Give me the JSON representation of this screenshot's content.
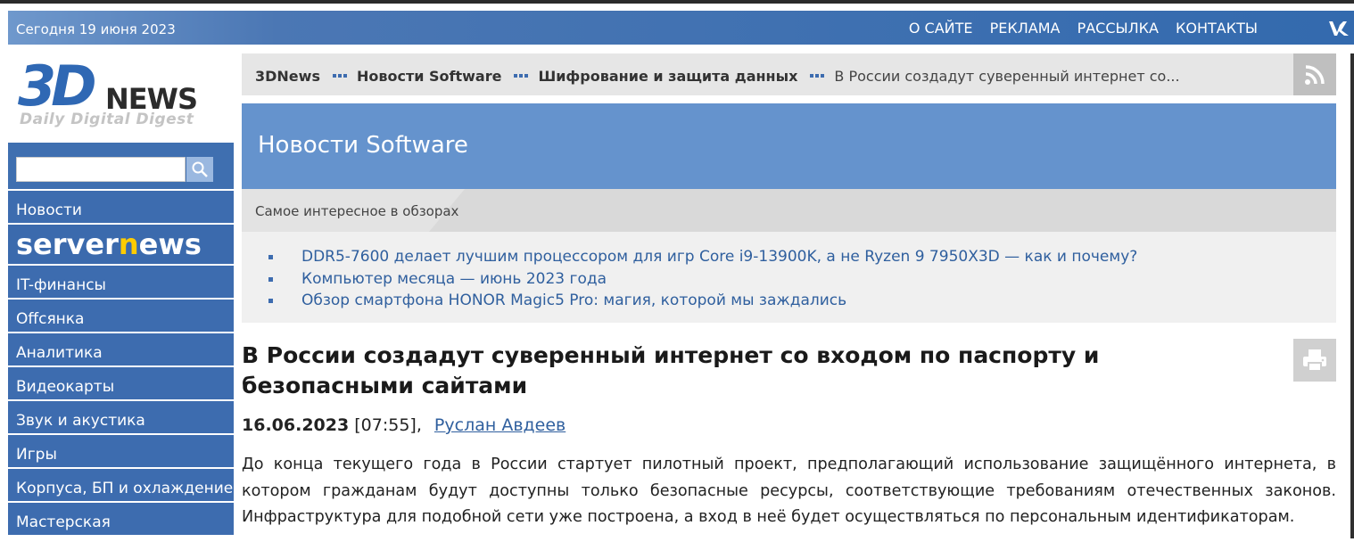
{
  "topbar": {
    "date": "Сегодня 19 июня 2023",
    "menu": [
      "О САЙТЕ",
      "РЕКЛАМА",
      "РАССЫЛКА",
      "КОНТАКТЫ"
    ],
    "social_icon": "vk-icon"
  },
  "logo": {
    "big": "3D",
    "news": "NEWS",
    "tagline": "Daily Digital Digest"
  },
  "search": {
    "value": "",
    "icon": "search-icon"
  },
  "nav": [
    "Новости",
    "servernews",
    "IT-финансы",
    "Offсянка",
    "Аналитика",
    "Видеокарты",
    "Звук и акустика",
    "Игры",
    "Корпуса, БП и охлаждение",
    "Мастерская"
  ],
  "breadcrumb": {
    "items": [
      "3DNews",
      "Новости Software",
      "Шифрование и защита данных"
    ],
    "current": "В России создадут суверенный интернет со..."
  },
  "section": {
    "title": "Новости Software"
  },
  "interesting": {
    "heading": "Самое интересное в обзорах",
    "items": [
      "DDR5-7600 делает лучшим процессором для игр Core i9-13900K, а не Ryzen 9 7950X3D — как и почему?",
      "Компьютер месяца — июнь 2023 года",
      "Обзор смартфона HONOR Magic5 Pro: магия, которой мы заждались"
    ]
  },
  "article": {
    "title": "В России создадут суверенный интернет со входом по паспорту и безопасными сайтами",
    "date": "16.06.2023",
    "time": "[07:55],",
    "author": "Руслан Авдеев",
    "lead": "До конца текущего года в России стартует пилотный проект, предполагающий использование защищённого интернета, в котором гражданам будут доступны только безопасные ресурсы, соответствующие требованиям отечественных законов. Инфраструктура для подобной сети уже построена, а вход в неё будет осуществляться по персональным идентификаторам."
  },
  "colors": {
    "brand_blue": "#3d6caf",
    "section_blue": "#6593cd",
    "link": "#2f5f9e"
  }
}
